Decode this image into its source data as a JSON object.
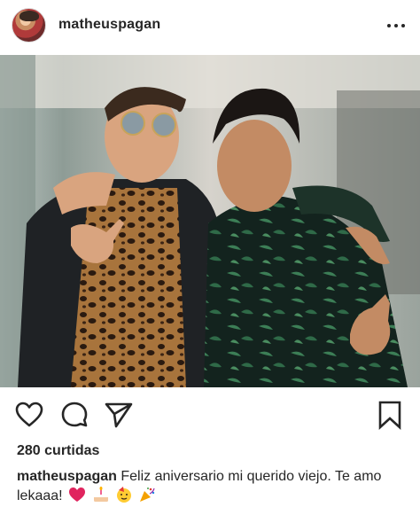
{
  "post": {
    "username": "matheuspagan",
    "more_icon": "more-horizontal-icon",
    "photo_alt": "Two men posing together",
    "likes": "280 curtidas",
    "caption_username": "matheuspagan",
    "caption_text": "Feliz aniversario mi querido viejo. Te amo lekaaa!",
    "caption_emojis": [
      "heart-icon",
      "birthday-cake-icon",
      "partying-face-icon",
      "party-popper-icon"
    ]
  },
  "actions": {
    "like_icon": "heart-outline-icon",
    "comment_icon": "comment-icon",
    "share_icon": "send-icon",
    "save_icon": "bookmark-icon"
  },
  "colors": {
    "text": "#262626",
    "heart_emoji": "#e0245e"
  }
}
